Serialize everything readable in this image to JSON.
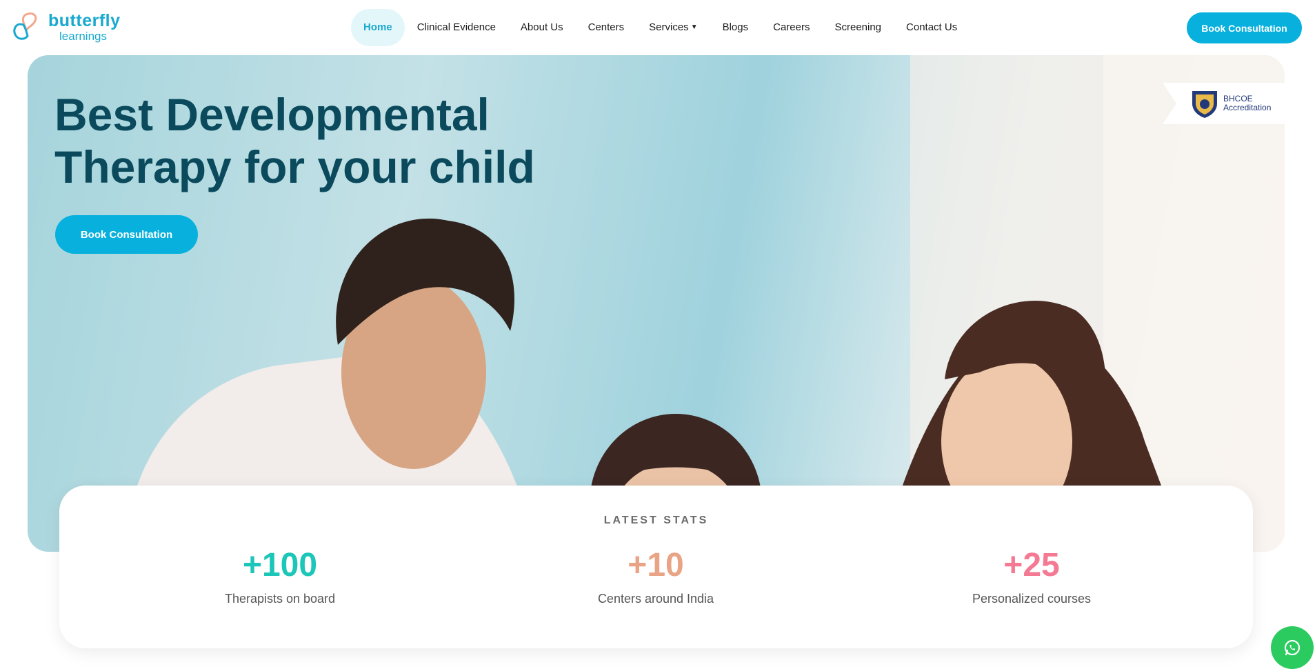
{
  "brand": {
    "name_line1": "butterfly",
    "name_line2": "learnings"
  },
  "nav": {
    "items": [
      {
        "label": "Home",
        "active": true
      },
      {
        "label": "Clinical Evidence"
      },
      {
        "label": "About Us"
      },
      {
        "label": "Centers"
      },
      {
        "label": "Services",
        "has_dropdown": true
      },
      {
        "label": "Blogs"
      },
      {
        "label": "Careers"
      },
      {
        "label": "Screening"
      },
      {
        "label": "Contact Us"
      }
    ],
    "cta_label": "Book Consultation"
  },
  "hero": {
    "title_line1": "Best Developmental",
    "title_line2": "Therapy for your child",
    "cta_label": "Book Consultation",
    "badge": {
      "line1": "BHCOE",
      "line2": "Accreditation"
    }
  },
  "stats": {
    "heading": "LATEST STATS",
    "items": [
      {
        "value": "+100",
        "label": "Therapists on board",
        "color": "#1cc6b8"
      },
      {
        "value": "+10",
        "label": "Centers around India",
        "color": "#e9a385"
      },
      {
        "value": "+25",
        "label": "Personalized courses",
        "color": "#f47a93"
      }
    ]
  },
  "colors": {
    "accent": "#08b1dd",
    "title": "#0a4a5c",
    "whatsapp": "#2ccb5f"
  },
  "icons": {
    "chat": "whatsapp-icon",
    "dropdown": "chevron-down-icon"
  }
}
